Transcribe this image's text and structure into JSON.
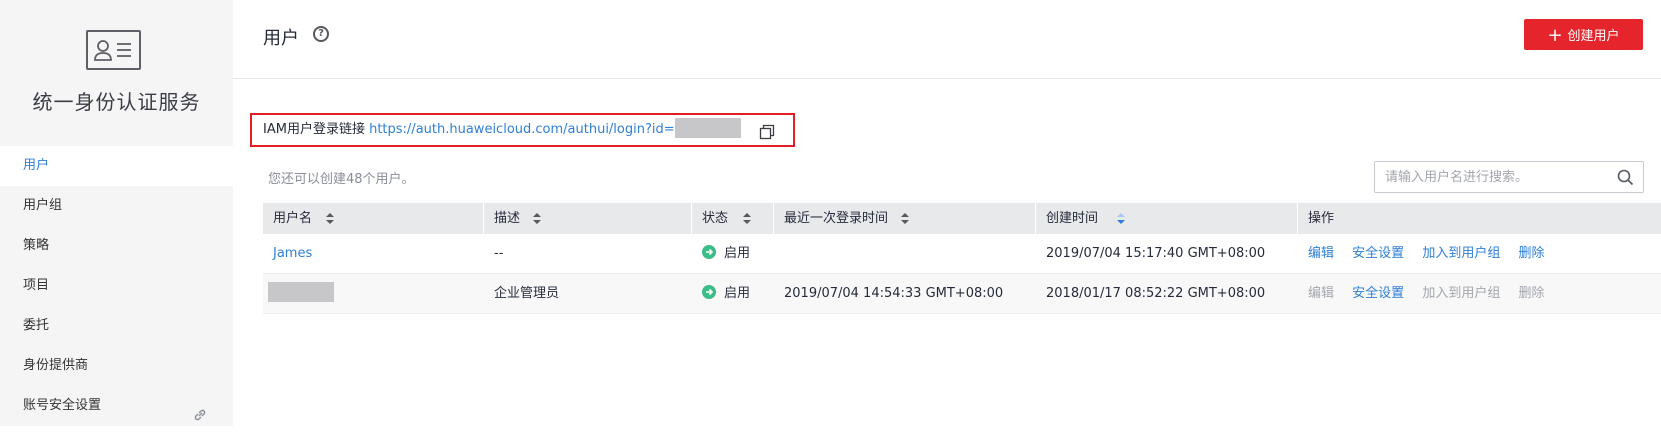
{
  "sidebar": {
    "brand_icon": "user-card-icon",
    "title": "统一身份认证服务",
    "items": [
      {
        "label": "用户",
        "active": true
      },
      {
        "label": "用户组"
      },
      {
        "label": "策略"
      },
      {
        "label": "项目"
      },
      {
        "label": "委托"
      },
      {
        "label": "身份提供商"
      },
      {
        "label": "账号安全设置",
        "icon": "link-icon"
      }
    ]
  },
  "header": {
    "title": "用户",
    "help_icon": "question-circle-icon",
    "create_button": "创建用户"
  },
  "login_link": {
    "label": "IAM用户登录链接",
    "url": "https://auth.huaweicloud.com/authui/login?id=",
    "copy_icon": "copy-icon"
  },
  "hint": "您还可以创建48个用户。",
  "search": {
    "placeholder": "请输入用户名进行搜索。"
  },
  "table": {
    "columns": [
      "用户名",
      "描述",
      "状态",
      "最近一次登录时间",
      "创建时间",
      "操作"
    ],
    "rows": [
      {
        "name": "James",
        "description": "--",
        "status": "启用",
        "last_login": "",
        "created": "2019/07/04 15:17:40 GMT+08:00",
        "ops": [
          "编辑",
          "安全设置",
          "加入到用户组",
          "删除"
        ]
      },
      {
        "name": "",
        "description": "企业管理员",
        "status": "启用",
        "last_login": "2019/07/04 14:54:33 GMT+08:00",
        "created": "2018/01/17 08:52:22 GMT+08:00",
        "ops": [
          "编辑",
          "安全设置",
          "加入到用户组",
          "删除"
        ]
      }
    ]
  },
  "colors": {
    "accent": "#2e7fd8",
    "danger": "#e6242c",
    "status_ok": "#3bbd88"
  }
}
